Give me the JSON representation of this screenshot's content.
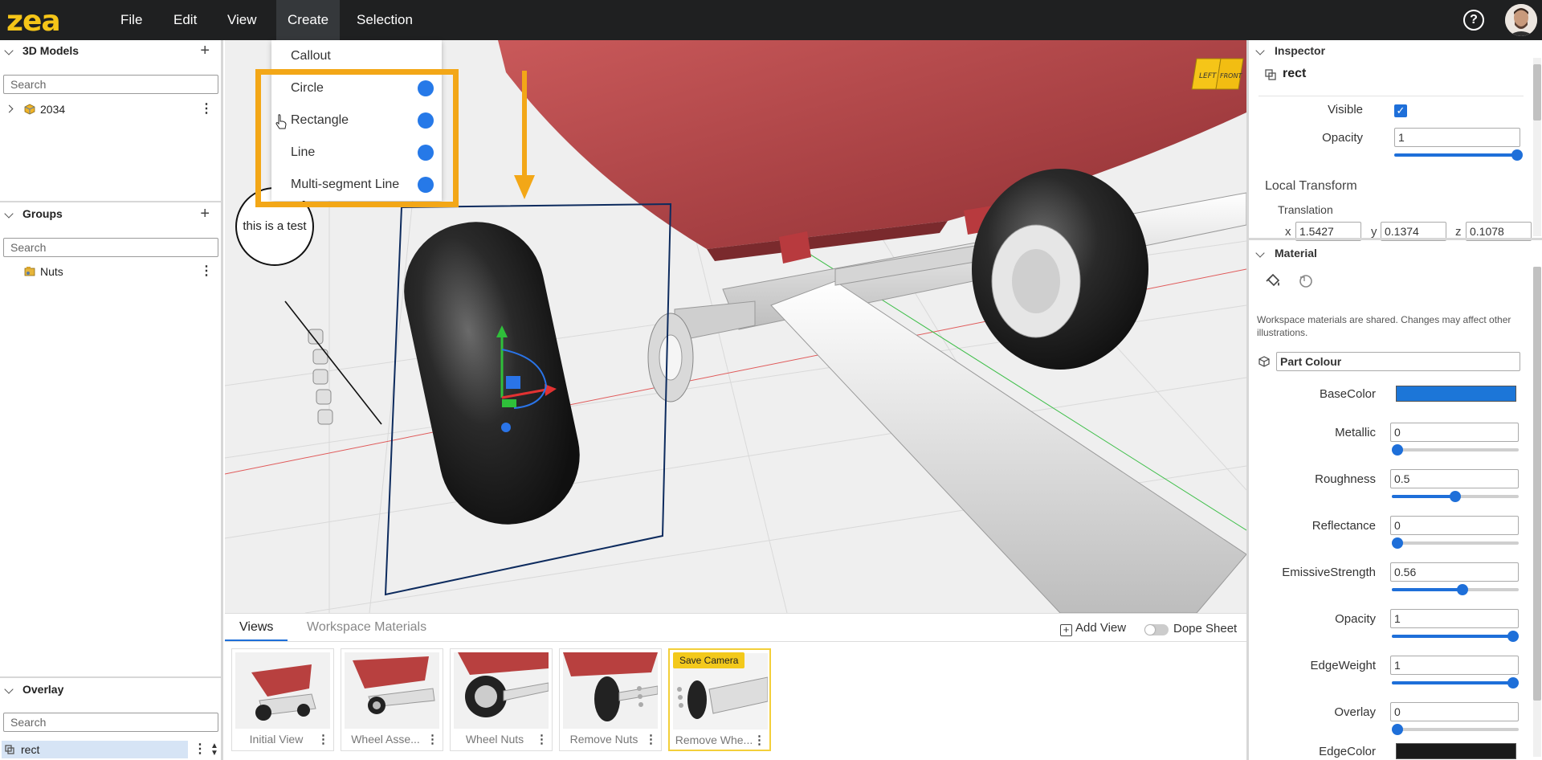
{
  "topbar": {
    "logo_text": "zea",
    "menu": [
      "File",
      "Edit",
      "View",
      "Create",
      "Selection"
    ],
    "active_menu": "Create"
  },
  "create_menu": {
    "items": [
      "Callout",
      "Circle",
      "Rectangle",
      "Line",
      "Multi-segment Line"
    ]
  },
  "left": {
    "models": {
      "title": "3D Models",
      "search_placeholder": "Search",
      "items": [
        "2034"
      ]
    },
    "groups": {
      "title": "Groups",
      "search_placeholder": "Search",
      "items": [
        "Nuts"
      ]
    },
    "overlay": {
      "title": "Overlay",
      "search_placeholder": "Search",
      "items": [
        "rect"
      ]
    }
  },
  "viewport": {
    "callout_text": "this is a test",
    "viewcube_faces": [
      "LEFT",
      "FRONT"
    ]
  },
  "views_panel": {
    "tabs": [
      "Views",
      "Workspace Materials"
    ],
    "active_tab": "Views",
    "add_view_label": "Add View",
    "dope_sheet_label": "Dope Sheet",
    "cards": [
      {
        "label": "Initial View"
      },
      {
        "label": "Wheel Asse..."
      },
      {
        "label": "Wheel Nuts"
      },
      {
        "label": "Remove Nuts"
      },
      {
        "label": "Remove Whe...",
        "badge": "Save Camera",
        "selected": true
      }
    ]
  },
  "inspector": {
    "title": "Inspector",
    "object_name": "rect",
    "visible_label": "Visible",
    "visible": true,
    "opacity_label": "Opacity",
    "opacity": "1",
    "local_transform_label": "Local Transform",
    "translation_label": "Translation",
    "translation": {
      "x": "1.5427",
      "y": "0.1374",
      "z": "0.1078"
    }
  },
  "material": {
    "title": "Material",
    "note": "Workspace materials are shared. Changes may affect other illustrations.",
    "name": "Part Colour",
    "base_color_label": "BaseColor",
    "base_color": "#1c76d8",
    "params": [
      {
        "label": "Metallic",
        "value": "0",
        "fraction": 0.0
      },
      {
        "label": "Roughness",
        "value": "0.5",
        "fraction": 0.5
      },
      {
        "label": "Reflectance",
        "value": "0",
        "fraction": 0.0
      },
      {
        "label": "EmissiveStrength",
        "value": "0.56",
        "fraction": 0.56
      },
      {
        "label": "Opacity",
        "value": "1",
        "fraction": 1.0
      },
      {
        "label": "EdgeWeight",
        "value": "1",
        "fraction": 1.0
      },
      {
        "label": "Overlay",
        "value": "0",
        "fraction": 0.0
      }
    ],
    "edge_color_label": "EdgeColor",
    "edge_color": "#1a1a1a"
  },
  "colors": {
    "accent": "#1e6fd9",
    "highlight": "#f3a717",
    "topbar": "#1f2021",
    "logo": "#f5c518"
  }
}
